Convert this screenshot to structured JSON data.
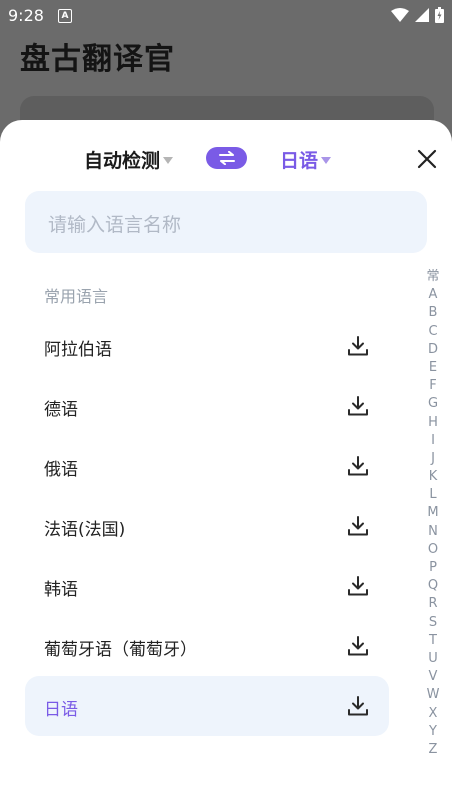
{
  "status_bar": {
    "time": "9:28",
    "notification_badge": "A"
  },
  "background_app": {
    "title": "盘古翻译官"
  },
  "sheet": {
    "source_lang": "自动检测",
    "target_lang": "日语",
    "search": {
      "placeholder": "请输入语言名称"
    },
    "section_label": "常用语言",
    "languages": [
      {
        "name": "阿拉伯语"
      },
      {
        "name": "德语"
      },
      {
        "name": "俄语"
      },
      {
        "name": "法语(法国)"
      },
      {
        "name": "韩语"
      },
      {
        "name": "葡萄牙语（葡萄牙）"
      },
      {
        "name": "日语",
        "selected": true
      }
    ],
    "index_letters": [
      "常",
      "A",
      "B",
      "C",
      "D",
      "E",
      "F",
      "G",
      "H",
      "I",
      "J",
      "K",
      "L",
      "M",
      "N",
      "O",
      "P",
      "Q",
      "R",
      "S",
      "T",
      "U",
      "V",
      "W",
      "X",
      "Y",
      "Z"
    ]
  },
  "colors": {
    "accent": "#7a5be6",
    "selected_bg": "#eef4fc",
    "scrim": "#6b6b6b"
  }
}
